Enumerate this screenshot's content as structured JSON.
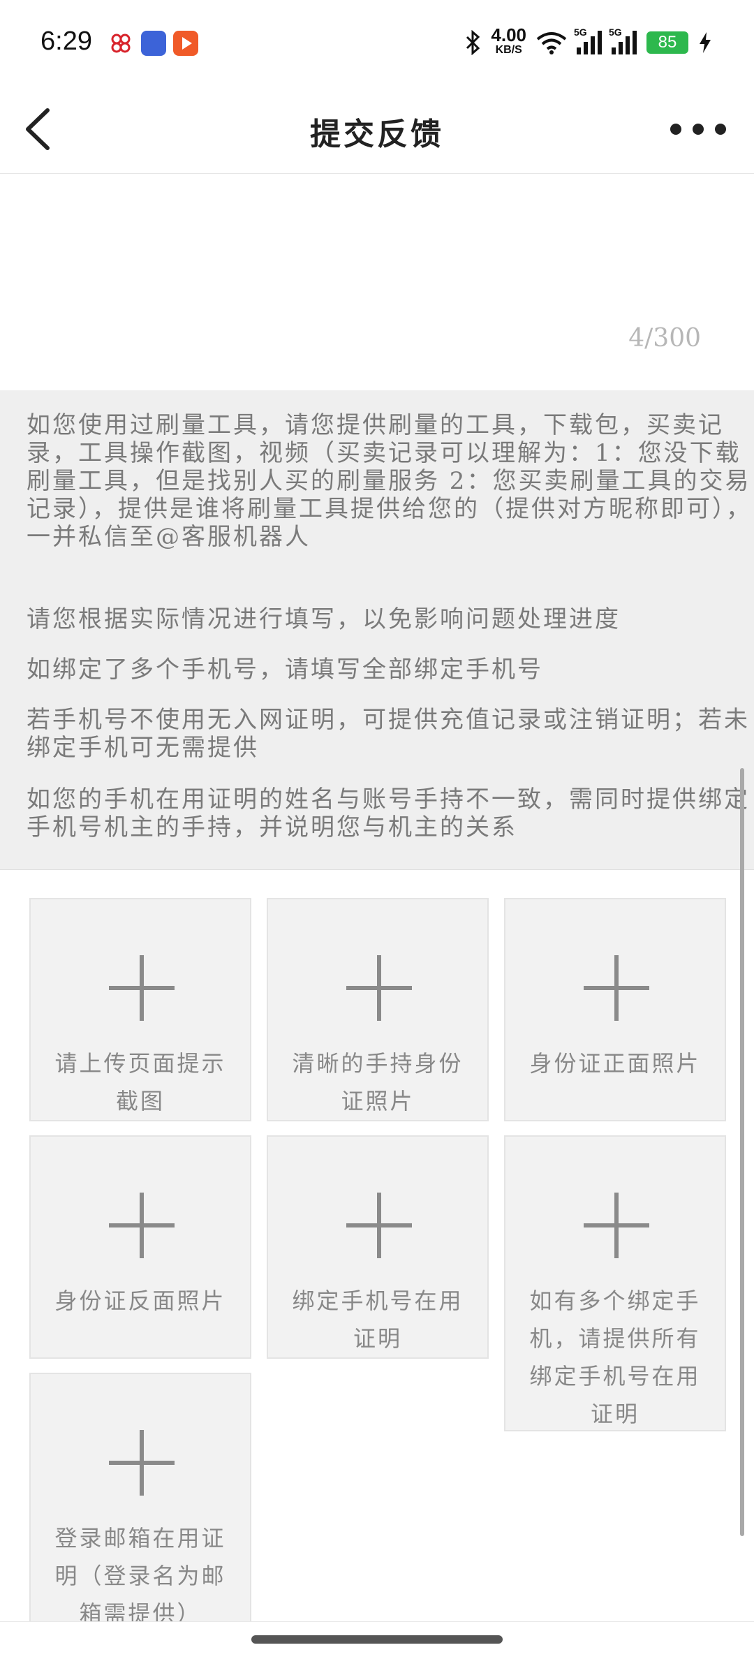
{
  "status": {
    "time": "6:29",
    "net_speed": "4.00",
    "net_unit": "KB/S",
    "sim1": "5G",
    "sim2": "5G",
    "battery": "85"
  },
  "header": {
    "title": "提交反馈"
  },
  "input": {
    "counter": "4/300"
  },
  "tips": [
    "如您使用过刷量工具，请您提供刷量的工具，下载包，买卖记录，工具操作截图，视频（买卖记录可以理解为：1：您没下载刷量工具，但是找别人买的刷量服务 2：您买卖刷量工具的交易记录），提供是谁将刷量工具提供给您的（提供对方昵称即可），一并私信至@客服机器人",
    "请您根据实际情况进行填写，以免影响问题处理进度",
    "如绑定了多个手机号，请填写全部绑定手机号",
    "若手机号不使用无入网证明，可提供充值记录或注销证明；若未绑定手机可无需提供",
    "如您的手机在用证明的姓名与账号手持不一致，需同时提供绑定手机号机主的手持，并说明您与机主的关系"
  ],
  "uploads": [
    "请上传页面提示截图",
    "清晰的手持身份证照片",
    "身份证正面照片",
    "身份证反面照片",
    "绑定手机号在用证明",
    "如有多个绑定手机，请提供所有绑定手机号在用证明",
    "登录邮箱在用证明（登录名为邮箱需提供）"
  ]
}
